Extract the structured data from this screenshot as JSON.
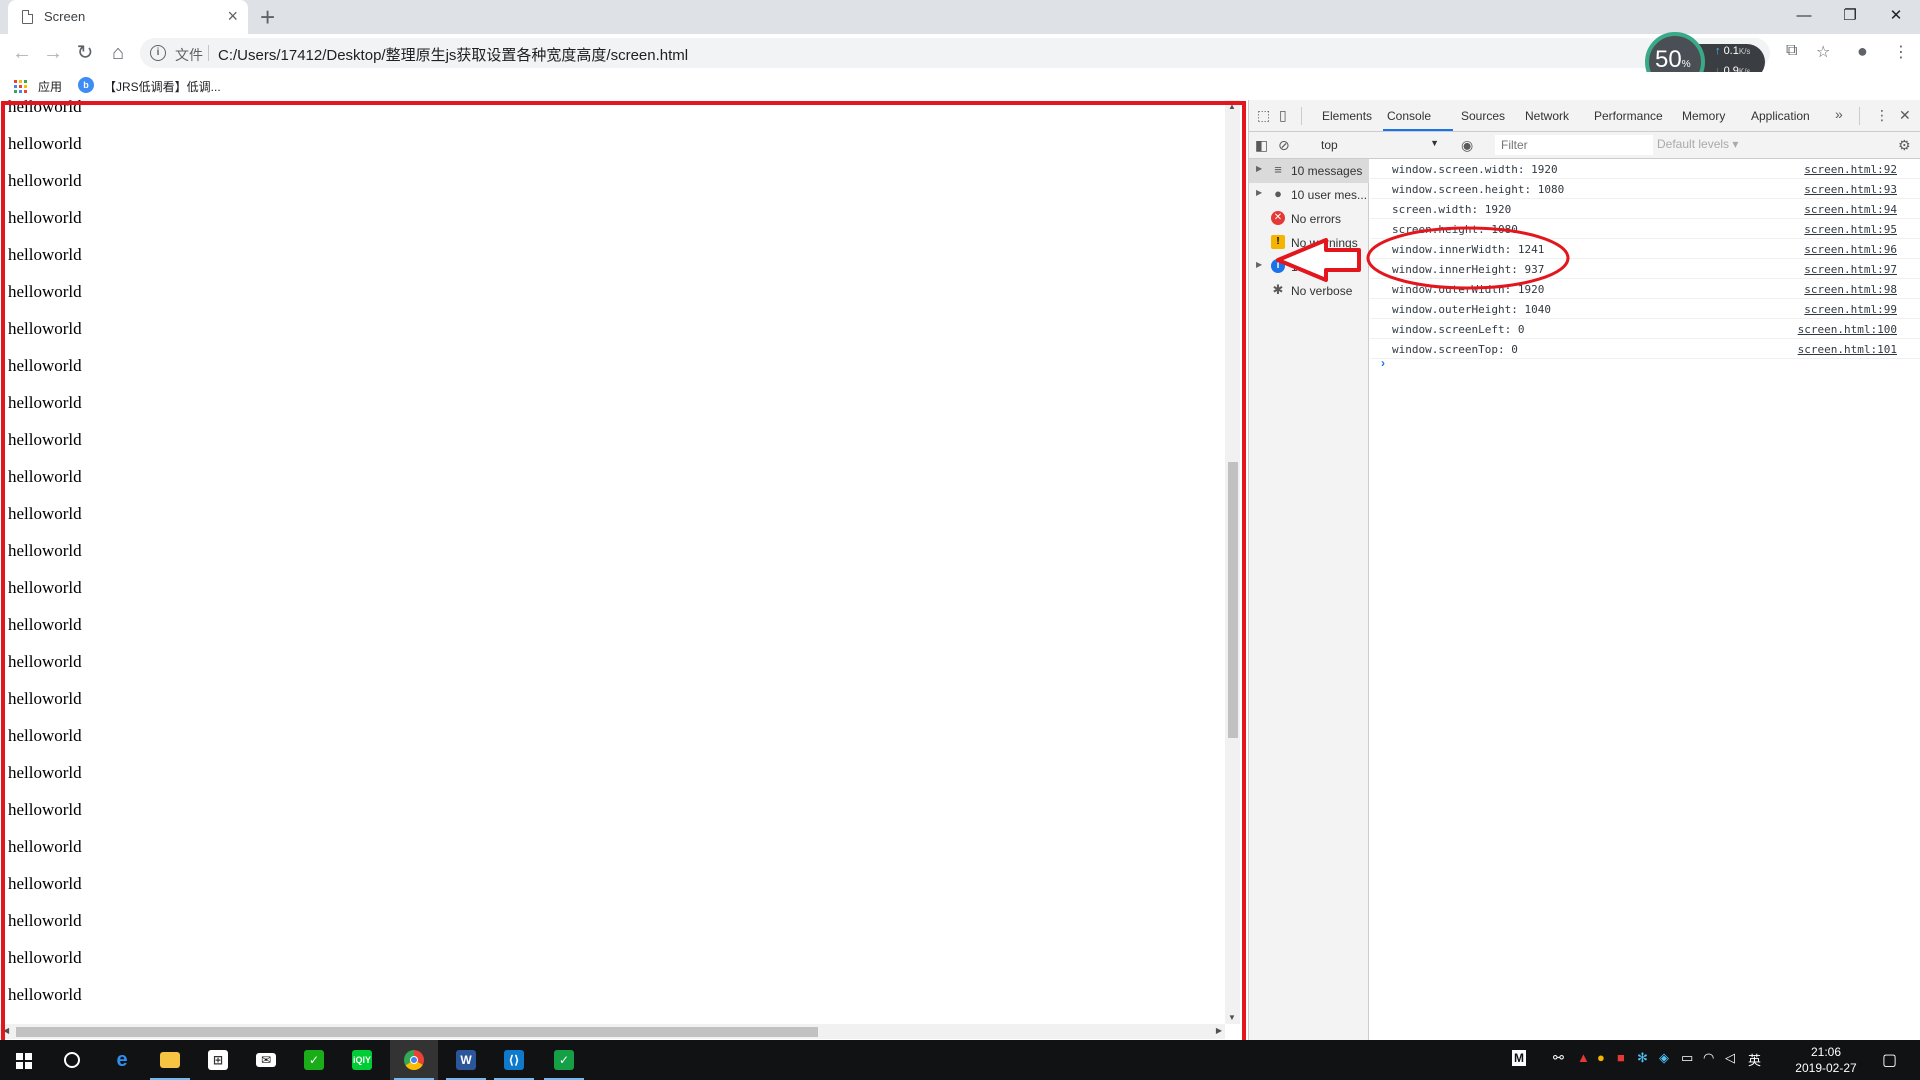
{
  "window": {
    "tab_title": "Screen",
    "tab_close": "×",
    "new_tab": "+",
    "minimize": "—",
    "restore": "❐",
    "close": "✕"
  },
  "toolbar": {
    "scheme_label": "文件",
    "url": "C:/Users/17412/Desktop/整理原生js获取设置各种宽度高度/screen.html",
    "net_percent": "50",
    "net_percent_unit": "%",
    "upload": "0.1",
    "download": "0.9",
    "rate_unit": "K/s"
  },
  "bookmarks": {
    "apps_label": "应用",
    "item_label": "【JRS低调看】低调..."
  },
  "page": {
    "lines": [
      "helloworld",
      "helloworld",
      "helloworld",
      "helloworld",
      "helloworld",
      "helloworld",
      "helloworld",
      "helloworld",
      "helloworld",
      "helloworld",
      "helloworld",
      "helloworld",
      "helloworld",
      "helloworld",
      "helloworld",
      "helloworld",
      "helloworld",
      "helloworld",
      "helloworld",
      "helloworld",
      "helloworld",
      "helloworld",
      "helloworld",
      "helloworld",
      "helloworld"
    ]
  },
  "devtools": {
    "tabs": [
      "Elements",
      "Console",
      "Sources",
      "Network",
      "Performance",
      "Memory",
      "Application"
    ],
    "active_tab": "Console",
    "more_tabs": "»",
    "context": "top",
    "filter_placeholder": "Filter",
    "levels": "Default levels ▾",
    "sidebar": [
      {
        "label": "10 messages",
        "icon": "list-icon",
        "color": "#5a5a5a",
        "selected": true,
        "expandable": true
      },
      {
        "label": "10 user mes...",
        "icon": "user-icon",
        "color": "#5a5a5a",
        "selected": false,
        "expandable": true
      },
      {
        "label": "No errors",
        "icon": "error-icon",
        "color": "#e53935",
        "selected": false,
        "expandable": false
      },
      {
        "label": "No warnings",
        "icon": "warning-icon",
        "color": "#f4b400",
        "selected": false,
        "expandable": false
      },
      {
        "label": "10 info",
        "icon": "info-icon",
        "color": "#1a73e8",
        "selected": false,
        "expandable": true
      },
      {
        "label": "No verbose",
        "icon": "bug-icon",
        "color": "#5a5a5a",
        "selected": false,
        "expandable": false
      }
    ],
    "messages": [
      {
        "text": "window.screen.width: 1920",
        "source": "screen.html:92"
      },
      {
        "text": "window.screen.height: 1080",
        "source": "screen.html:93"
      },
      {
        "text": "screen.width: 1920",
        "source": "screen.html:94"
      },
      {
        "text": "screen.height: 1080",
        "source": "screen.html:95"
      },
      {
        "text": "window.innerWidth: 1241",
        "source": "screen.html:96"
      },
      {
        "text": "window.innerHeight: 937",
        "source": "screen.html:97"
      },
      {
        "text": "window.outerWidth: 1920",
        "source": "screen.html:98"
      },
      {
        "text": "window.outerHeight: 1040",
        "source": "screen.html:99"
      },
      {
        "text": "window.screenLeft: 0",
        "source": "screen.html:100"
      },
      {
        "text": "window.screenTop: 0",
        "source": "screen.html:101"
      }
    ],
    "prompt": "›"
  },
  "taskbar": {
    "clock_time": "21:06",
    "clock_date": "2019-02-27",
    "ime": "英",
    "tray_m": "M"
  },
  "colors": {
    "highlight_red": "#e3161e",
    "accent_blue": "#1a73e8"
  }
}
